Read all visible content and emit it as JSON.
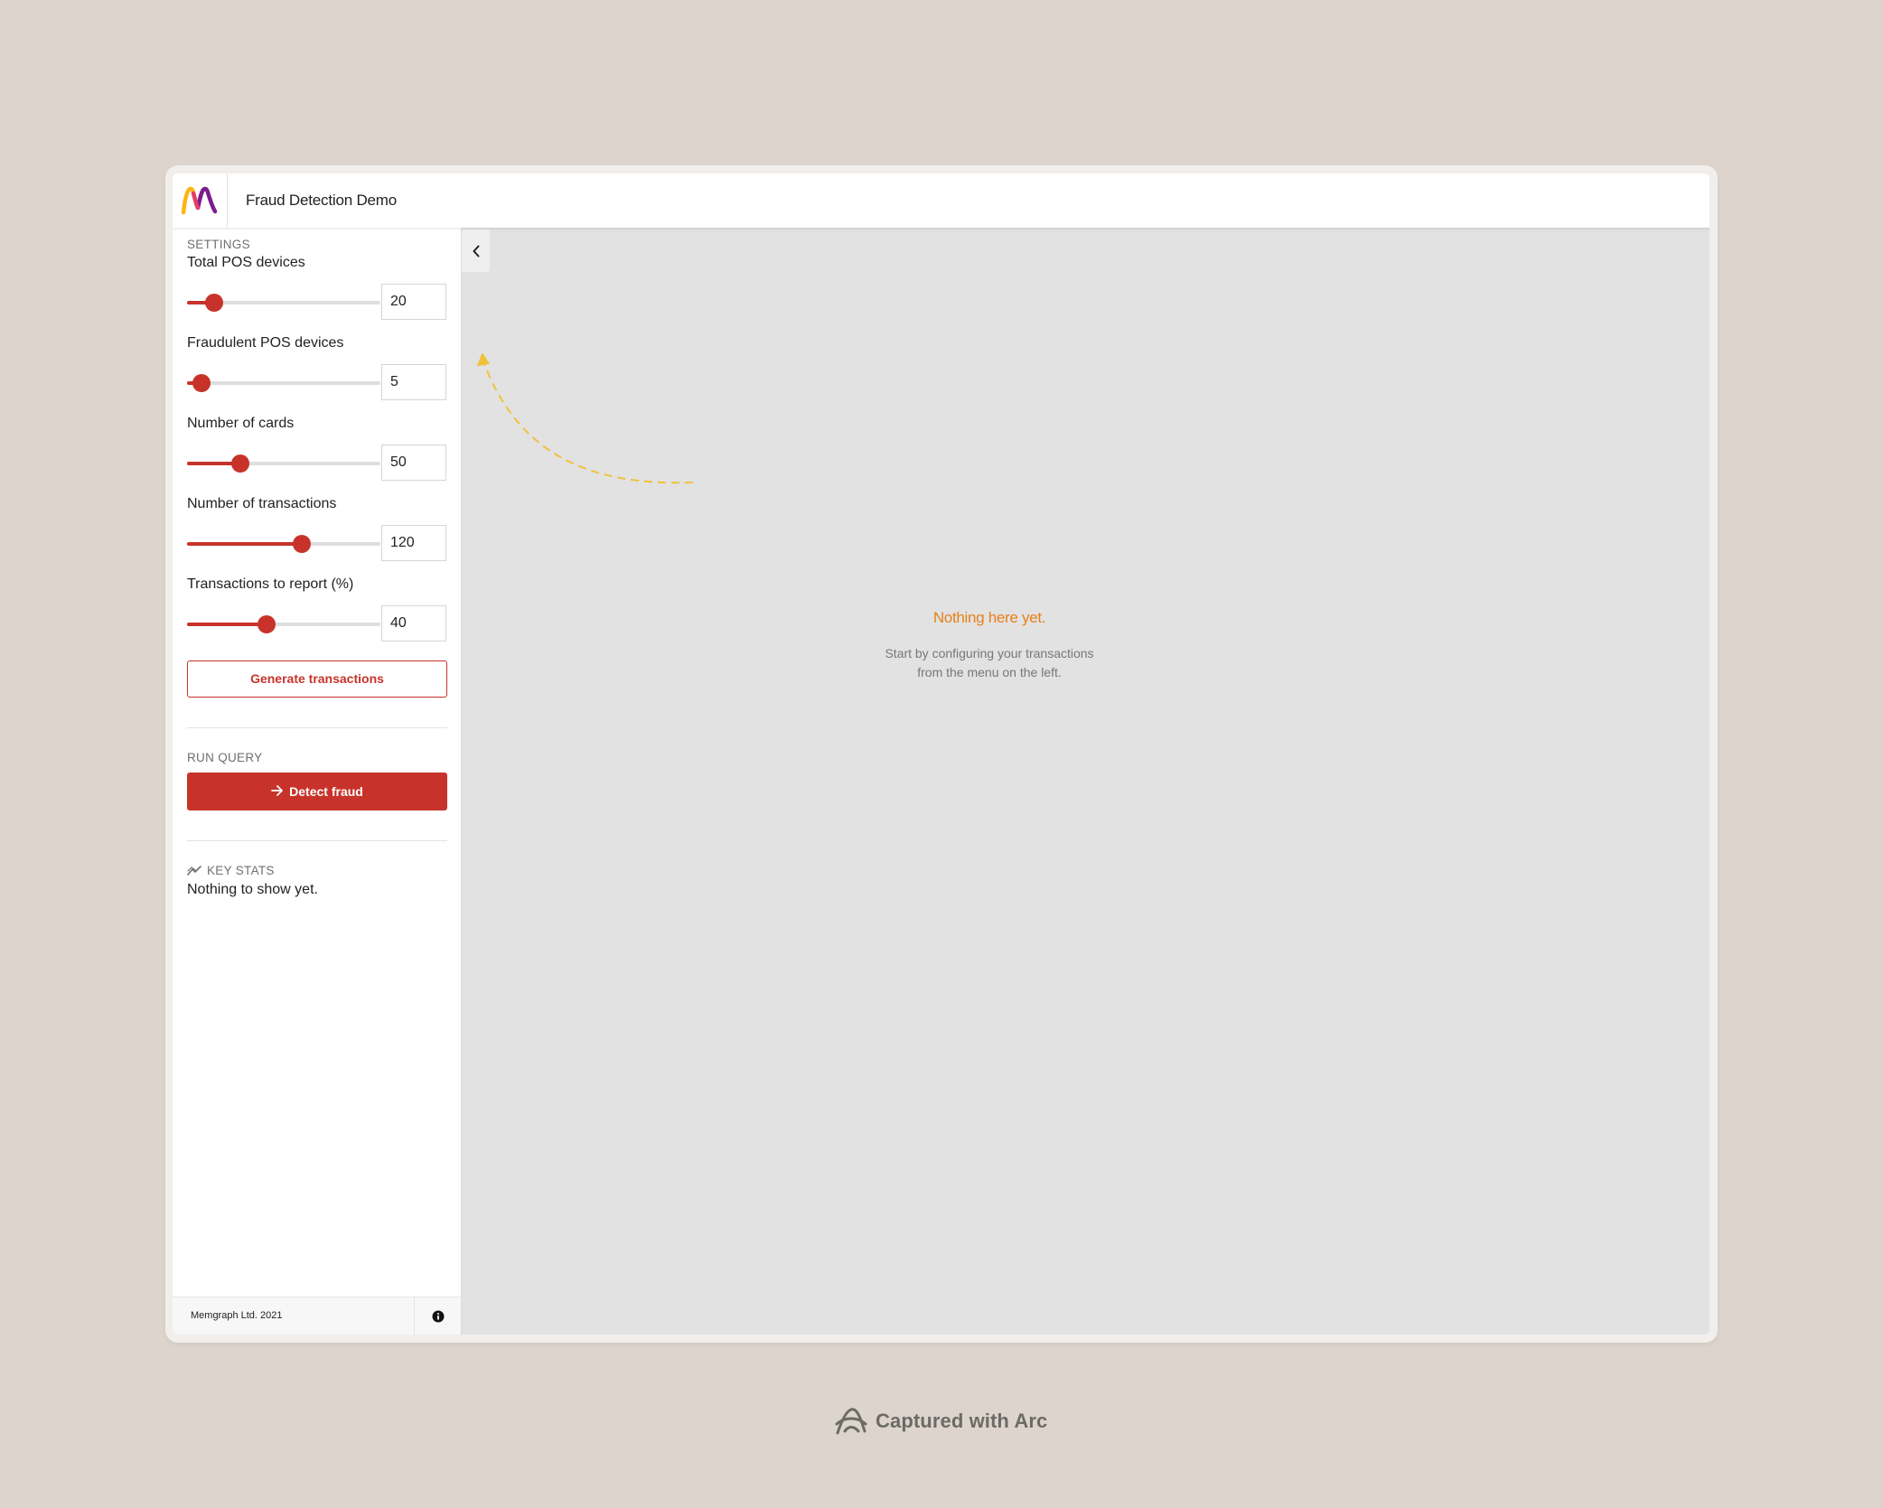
{
  "header": {
    "app_title": "Fraud Detection Demo"
  },
  "settings": {
    "section_label": "SETTINGS",
    "fields": [
      {
        "label": "Total POS devices",
        "value": "20",
        "slider_fraction": 0.14
      },
      {
        "label": "Fraudulent POS devices",
        "value": "5",
        "slider_fraction": 0.075
      },
      {
        "label": "Number of cards",
        "value": "50",
        "slider_fraction": 0.275
      },
      {
        "label": "Number of transactions",
        "value": "120",
        "slider_fraction": 0.595
      },
      {
        "label": "Transactions to report (%)",
        "value": "40",
        "slider_fraction": 0.41
      }
    ],
    "generate_button_label": "Generate transactions"
  },
  "run_query": {
    "section_label": "RUN QUERY",
    "detect_button_label": "Detect fraud",
    "detect_button_icon": "arrow-right-icon"
  },
  "key_stats": {
    "section_label": "KEY STATS",
    "icon": "trending-chart-icon",
    "empty_text": "Nothing to show yet."
  },
  "footer": {
    "copyright": "Memgraph Ltd. 2021",
    "info_icon": "info-icon"
  },
  "main": {
    "empty_title": "Nothing here yet.",
    "empty_desc_line1": "Start by configuring your transactions",
    "empty_desc_line2": "from the menu on the left."
  },
  "capture_badge": {
    "text": "Captured with Arc"
  },
  "colors": {
    "accent": "#c7332a",
    "empty_title": "#e6801a",
    "curve": "#f0c23a",
    "page_bg": "#ddd5cd"
  }
}
